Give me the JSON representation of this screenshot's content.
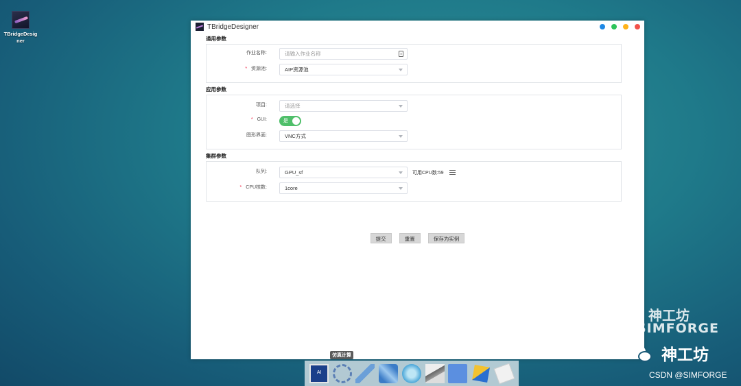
{
  "desktop": {
    "icon_label": "TBridgeDesigner"
  },
  "window": {
    "title": "TBridgeDesigner",
    "traffic_colors": [
      "#1e88e5",
      "#2ec45a",
      "#ffb31a",
      "#f2524a"
    ]
  },
  "sections": {
    "general": {
      "heading": "通用参数",
      "job_name_label": "作业名称:",
      "job_name_placeholder": "请输入作业名称",
      "resource_pool_label": "资源池:",
      "resource_pool_value": "AIP资源池"
    },
    "app": {
      "heading": "应用参数",
      "project_label": "项目:",
      "project_placeholder": "请选择",
      "gui_label": "GUI:",
      "gui_toggle_text": "是",
      "gui_on": true,
      "ui_label": "图形界面:",
      "ui_value": "VNC方式"
    },
    "cluster": {
      "heading": "集群参数",
      "queue_label": "队列:",
      "queue_value": "GPU_sf",
      "cpu_available": "可用CPU数:59",
      "cpu_cores_label": "CPU核数:",
      "cpu_cores_value": "1core"
    }
  },
  "actions": {
    "submit": "提交",
    "reset": "重置",
    "save_as_instance": "保存为实例"
  },
  "taskbar": {
    "tooltip": "仿真计算"
  },
  "watermark": {
    "brand_cn": "神工坊",
    "brand_en": "SIMFORGE",
    "wechat_name": "神工坊",
    "csdn": "CSDN @SIMFORGE"
  }
}
